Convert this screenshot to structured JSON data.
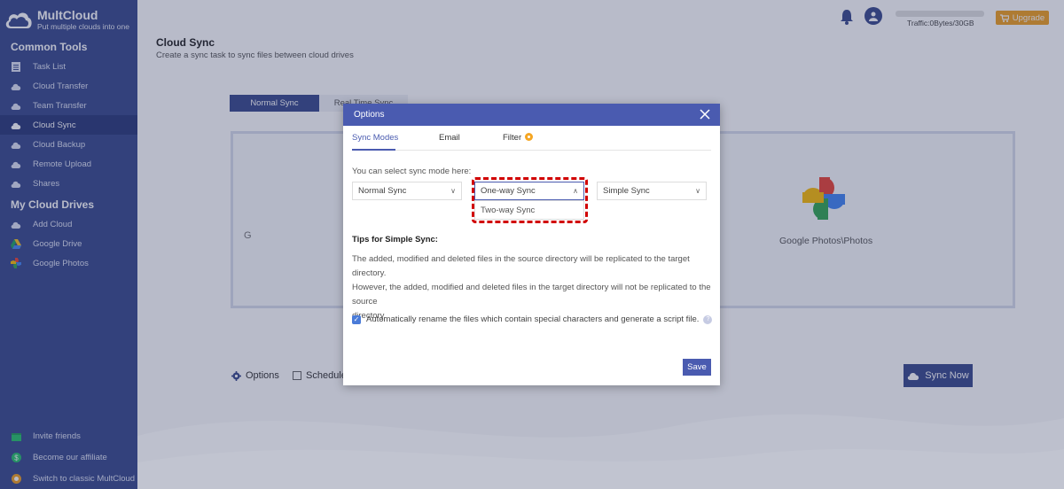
{
  "brand": {
    "name": "MultCloud",
    "tagline": "Put multiple clouds into one"
  },
  "sidebar": {
    "common_tools_title": "Common Tools",
    "common_tools": [
      {
        "label": "Task List",
        "icon": "list-icon"
      },
      {
        "label": "Cloud Transfer",
        "icon": "cloud-transfer-icon"
      },
      {
        "label": "Team Transfer",
        "icon": "team-transfer-icon"
      },
      {
        "label": "Cloud Sync",
        "icon": "cloud-sync-icon"
      },
      {
        "label": "Cloud Backup",
        "icon": "cloud-backup-icon"
      },
      {
        "label": "Remote Upload",
        "icon": "remote-upload-icon"
      },
      {
        "label": "Shares",
        "icon": "share-icon"
      }
    ],
    "cloud_drives_title": "My Cloud Drives",
    "cloud_drives": [
      {
        "label": "Add Cloud",
        "icon": "add-cloud-icon"
      },
      {
        "label": "Google Drive",
        "icon": "google-drive-icon"
      },
      {
        "label": "Google Photos",
        "icon": "google-photos-icon"
      }
    ],
    "bottom": [
      {
        "label": "Invite friends",
        "icon": "gift-icon"
      },
      {
        "label": "Become our affiliate",
        "icon": "dollar-icon"
      },
      {
        "label": "Switch to classic MultCloud",
        "icon": "switch-icon"
      }
    ]
  },
  "header": {
    "traffic": "Traffic:0Bytes/30GB",
    "upgrade": "Upgrade"
  },
  "main": {
    "title": "Cloud Sync",
    "subtitle": "Create a sync task to sync files between cloud drives",
    "tab_normal": "Normal Sync",
    "tab_realtime": "Real Time Sync",
    "source_partial": "G",
    "target_label": "Google Photos\\Photos",
    "options": "Options",
    "schedule": "Schedule",
    "sync_now": "Sync Now"
  },
  "modal": {
    "title": "Options",
    "tabs": {
      "sync_modes": "Sync Modes",
      "email": "Email",
      "filter": "Filter"
    },
    "select_label": "You can select sync mode here:",
    "select1": "Normal Sync",
    "select2": "One-way Sync",
    "select2_option": "Two-way Sync",
    "select3": "Simple Sync",
    "tips_title": "Tips for Simple Sync:",
    "tips_line1": "The added, modified and deleted files in the source directory will be replicated to the target directory.",
    "tips_line2": "However, the added, modified and deleted files in the target directory will not be replicated to the source",
    "tips_line3": "directory.",
    "auto_rename": "Automatically rename the files which contain special characters and generate a script file.",
    "save": "Save"
  },
  "colors": {
    "sidebar": "#3a4a8c",
    "accent": "#4a5bb0",
    "upgrade": "#f0a020",
    "highlight": "#d10000"
  }
}
